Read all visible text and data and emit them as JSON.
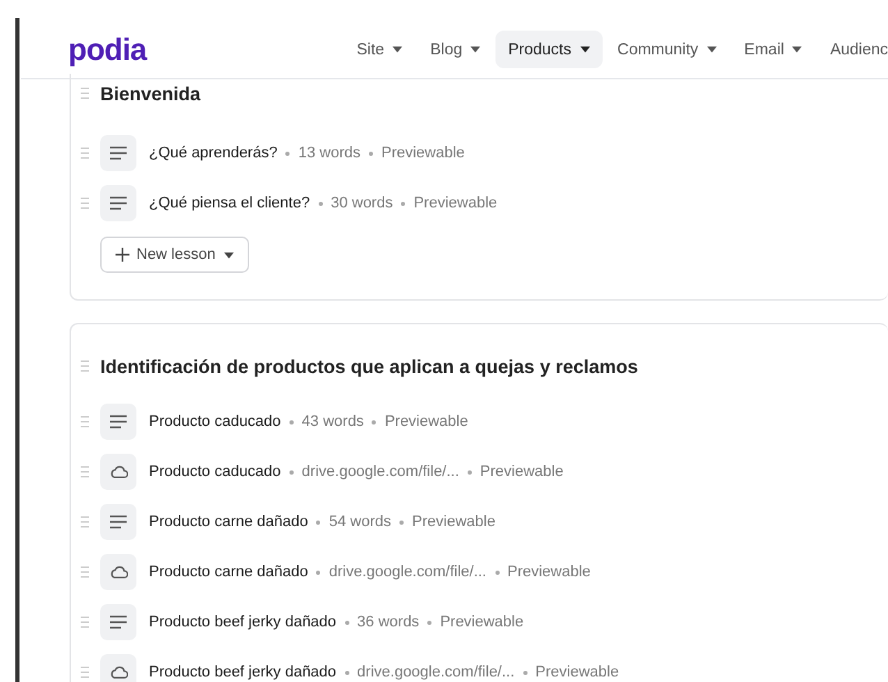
{
  "logo": "podia",
  "nav": [
    {
      "label": "Site",
      "selected": false
    },
    {
      "label": "Blog",
      "selected": false
    },
    {
      "label": "Products",
      "selected": true
    },
    {
      "label": "Community",
      "selected": false
    },
    {
      "label": "Email",
      "selected": false
    },
    {
      "label": "Audienc",
      "selected": false
    }
  ],
  "sections": [
    {
      "title": "Bienvenida",
      "new_lesson": "New lesson",
      "lessons": [
        {
          "kind": "text",
          "title": "¿Qué aprenderás?",
          "detail": "13 words",
          "status": "Previewable"
        },
        {
          "kind": "text",
          "title": "¿Qué piensa el cliente?",
          "detail": "30 words",
          "status": "Previewable"
        }
      ]
    },
    {
      "title": "Identificación de productos que aplican a quejas y reclamos",
      "lessons": [
        {
          "kind": "text",
          "title": "Producto caducado",
          "detail": "43 words",
          "status": "Previewable"
        },
        {
          "kind": "link",
          "title": "Producto caducado",
          "detail": "drive.google.com/file/...",
          "status": "Previewable"
        },
        {
          "kind": "text",
          "title": "Producto carne dañado",
          "detail": "54 words",
          "status": "Previewable"
        },
        {
          "kind": "link",
          "title": "Producto carne dañado",
          "detail": "drive.google.com/file/...",
          "status": "Previewable"
        },
        {
          "kind": "text",
          "title": "Producto beef jerky dañado",
          "detail": "36 words",
          "status": "Previewable"
        },
        {
          "kind": "link",
          "title": "Producto beef jerky dañado",
          "detail": "drive.google.com/file/...",
          "status": "Previewable"
        }
      ]
    }
  ]
}
